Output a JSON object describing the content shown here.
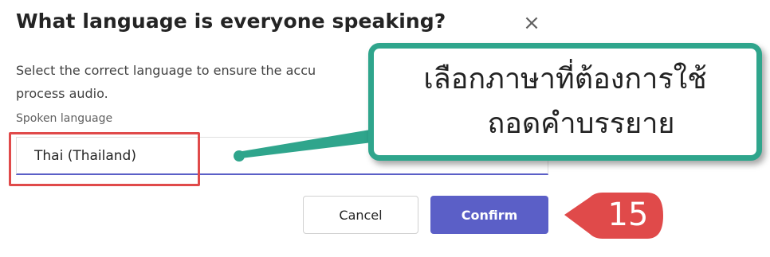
{
  "dialog": {
    "title": "What language is everyone speaking?",
    "close_icon": "close-icon",
    "description": "Select the correct language to ensure the accu… process audio.",
    "description_line1": "Select the correct language to ensure the accu",
    "description_line2": "process audio.",
    "field_label": "Spoken language",
    "selected_language": "Thai (Thailand)",
    "cancel_label": "Cancel",
    "confirm_label": "Confirm"
  },
  "annotation": {
    "callout_line1": "เลือกภาษาที่ต้องการใช้",
    "callout_line2": "ถอดคำบรรยาย",
    "step_number": "15",
    "highlight_color": "#e04a4a",
    "callout_color": "#2fa58c",
    "badge_color": "#e04a4a"
  },
  "colors": {
    "accent": "#5b5fc7"
  }
}
